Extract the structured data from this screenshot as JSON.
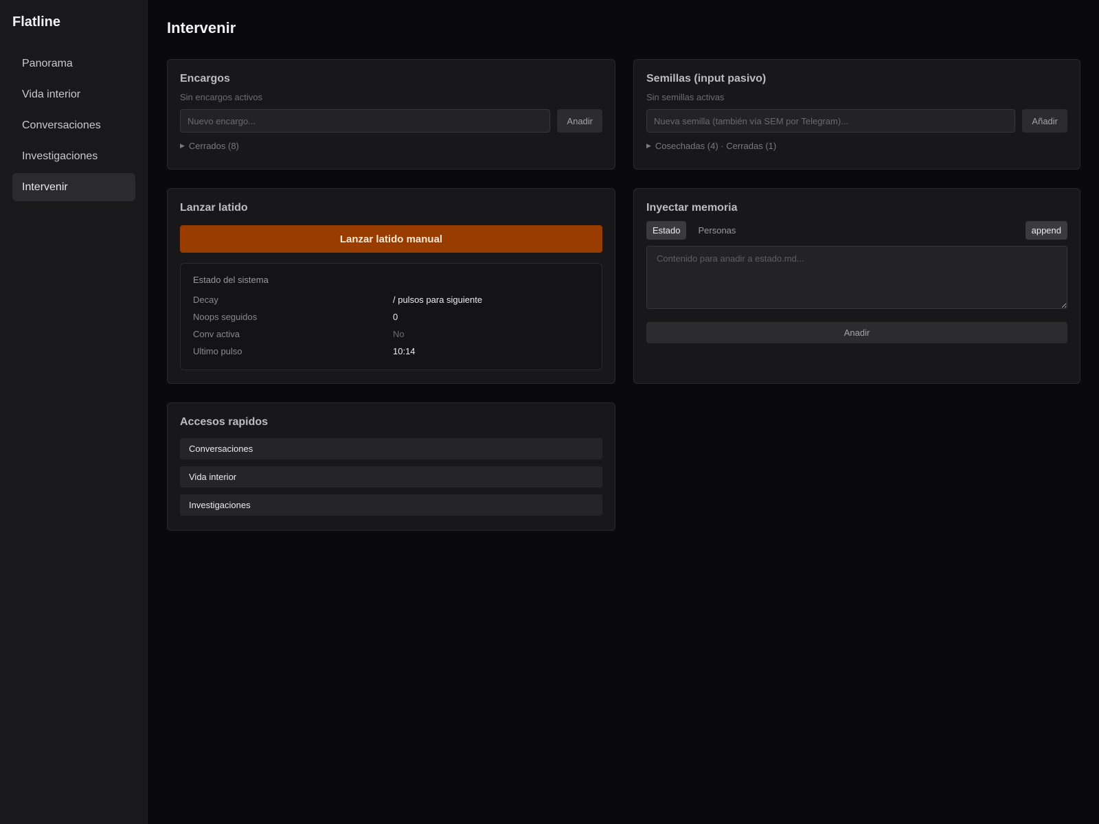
{
  "app": {
    "brand": "Flatline"
  },
  "sidebar": {
    "items": [
      {
        "label": "Panorama"
      },
      {
        "label": "Vida interior"
      },
      {
        "label": "Conversaciones"
      },
      {
        "label": "Investigaciones"
      },
      {
        "label": "Intervenir",
        "active": true
      }
    ]
  },
  "page": {
    "title": "Intervenir"
  },
  "encargos": {
    "title": "Encargos",
    "empty_text": "Sin encargos activos",
    "input_placeholder": "Nuevo encargo...",
    "add_label": "Anadir",
    "closed_label": "Cerrados (8)"
  },
  "semillas": {
    "title": "Semillas (input pasivo)",
    "empty_text": "Sin semillas activas",
    "input_placeholder": "Nueva semilla (también vía SEM por Telegram)...",
    "add_label": "Añadir",
    "closed_label": "Cosechadas (4) · Cerradas (1)"
  },
  "latido": {
    "title": "Lanzar latido",
    "button_label": "Lanzar latido manual",
    "status": {
      "title": "Estado del sistema",
      "rows": [
        {
          "key": "Decay",
          "value": "/ pulsos para siguiente"
        },
        {
          "key": "Noops seguidos",
          "value": "0"
        },
        {
          "key": "Conv activa",
          "value": "No"
        },
        {
          "key": "Ultimo pulso",
          "value": "10:14"
        }
      ]
    }
  },
  "memoria": {
    "title": "Inyectar memoria",
    "tabs": [
      {
        "label": "Estado",
        "active": true
      },
      {
        "label": "Personas",
        "active": false
      }
    ],
    "mode_label": "append",
    "textarea_placeholder": "Contenido para anadir a estado.md...",
    "submit_label": "Anadir"
  },
  "accesos": {
    "title": "Accesos rapidos",
    "links": [
      {
        "label": "Conversaciones"
      },
      {
        "label": "Vida interior"
      },
      {
        "label": "Investigaciones"
      }
    ]
  },
  "colors": {
    "background": "#0a0a0c",
    "sidebar": "#19191b",
    "card": "#18181a",
    "accent": "#993c00"
  }
}
